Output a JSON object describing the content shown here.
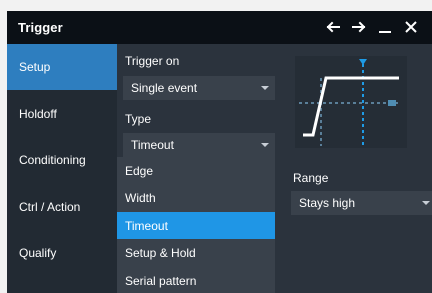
{
  "window": {
    "title": "Trigger",
    "controls": [
      "back-arrow-icon",
      "forward-arrow-icon",
      "minimize-icon",
      "close-icon"
    ]
  },
  "sidebar": {
    "items": [
      {
        "label": "Setup",
        "active": true
      },
      {
        "label": "Holdoff",
        "active": false
      },
      {
        "label": "Conditioning",
        "active": false
      },
      {
        "label": "Ctrl / Action",
        "active": false
      },
      {
        "label": "Qualify",
        "active": false
      }
    ]
  },
  "trigger_on": {
    "label": "Trigger on",
    "value": "Single event"
  },
  "type": {
    "label": "Type",
    "value": "Timeout",
    "options": [
      "Edge",
      "Width",
      "Timeout",
      "Setup & Hold",
      "Serial pattern"
    ],
    "selected": "Timeout"
  },
  "range": {
    "label": "Range",
    "value": "Stays high"
  },
  "colors": {
    "accent": "#2e7ebf",
    "selected_option": "#1f96e6",
    "marker": "#1e9be6",
    "waveform": "#ffffff",
    "dotted_guides": "#5a7f99"
  }
}
